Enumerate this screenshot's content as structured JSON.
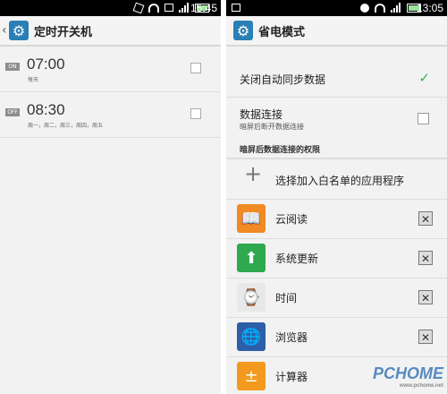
{
  "left": {
    "status_time": "15:45",
    "title": "定时开关机",
    "alarms": [
      {
        "badge": "ON",
        "time": "07:00",
        "repeat": "每天"
      },
      {
        "badge": "OFF",
        "time": "08:30",
        "repeat": "周一，周二，周三，周四，周五"
      }
    ]
  },
  "right": {
    "status_time": "13:05",
    "title": "省电模式",
    "auto_sync": {
      "label": "关闭自动同步数据",
      "checked": true
    },
    "data_conn": {
      "label": "数据连接",
      "sub": "暗屏后断开数据连接",
      "checked": false
    },
    "section_header": "暗屏后数据连接的权限",
    "add_whitelist_label": "选择加入白名单的应用程序",
    "apps": [
      {
        "name": "云阅读",
        "icon": "book-icon",
        "color": "#f08a24",
        "glyph": "📖"
      },
      {
        "name": "系统更新",
        "icon": "upload-arrow-icon",
        "color": "#2fa84f",
        "glyph": "⬆"
      },
      {
        "name": "时间",
        "icon": "clock-icon",
        "color": "#e8e8e8",
        "glyph": "⌚"
      },
      {
        "name": "浏览器",
        "icon": "globe-icon",
        "color": "#2d5fa8",
        "glyph": "🌐"
      },
      {
        "name": "计算器",
        "icon": "calculator-icon",
        "color": "#f39a1e",
        "glyph": "±"
      }
    ],
    "remove_symbol": "✕"
  },
  "watermark": {
    "main": "PCHOME",
    "sub": "www.pchome.net"
  }
}
